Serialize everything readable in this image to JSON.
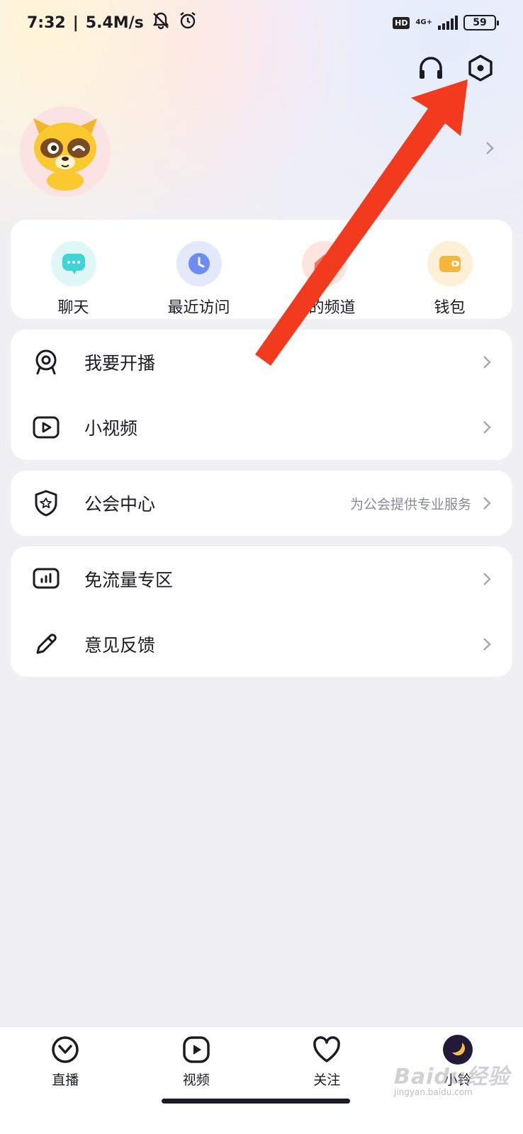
{
  "status_bar": {
    "time": "7:32",
    "speed": "5.4M/s",
    "hd": "HD",
    "network": "4G+",
    "battery": "59"
  },
  "quick_actions": [
    {
      "label": "聊天",
      "icon": "chat-icon",
      "color": "#3fd3d6"
    },
    {
      "label": "最近访问",
      "icon": "clock-icon",
      "color": "#6d8cf5"
    },
    {
      "label": "我的频道",
      "icon": "home-icon",
      "color": "#f2735f"
    },
    {
      "label": "钱包",
      "icon": "wallet-icon",
      "color": "#f7b63a"
    }
  ],
  "menu_groups": {
    "group1": [
      {
        "label": "我要开播",
        "icon": "webcam-icon"
      },
      {
        "label": "小视频",
        "icon": "video-icon"
      }
    ],
    "group2": [
      {
        "label": "公会中心",
        "sub": "为公会提供专业服务",
        "icon": "shield-star-icon"
      }
    ],
    "group3": [
      {
        "label": "免流量专区",
        "icon": "data-chart-icon"
      },
      {
        "label": "意见反馈",
        "icon": "pencil-icon"
      }
    ]
  },
  "bottom_nav": [
    {
      "label": "直播",
      "icon": "live-icon"
    },
    {
      "label": "视频",
      "icon": "play-icon"
    },
    {
      "label": "关注",
      "icon": "heart-icon"
    },
    {
      "label": "小铃",
      "icon": "avatar-icon"
    }
  ],
  "watermark": {
    "text": "Baidu经验",
    "sub": "jingyan.baidu.com"
  },
  "colors": {
    "arrow": "#f23a1e",
    "accent_dark": "#1b1b24",
    "background": "#efeff4"
  }
}
